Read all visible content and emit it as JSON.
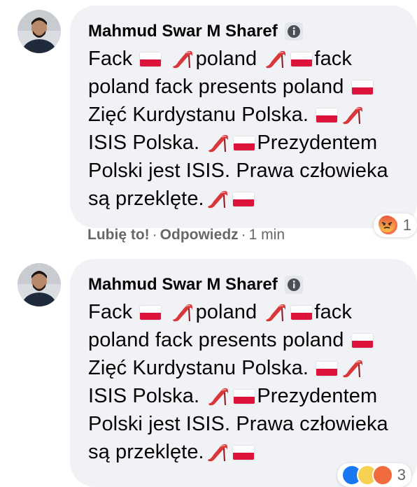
{
  "comments": [
    {
      "author": "Mahmud Swar M Sharef",
      "text_lines": [
        [
          {
            "t": "text",
            "v": "Fack "
          },
          {
            "t": "flag"
          },
          {
            "t": "text",
            "v": " "
          },
          {
            "t": "shoe"
          },
          {
            "t": "text",
            "v": "poland "
          },
          {
            "t": "shoe"
          },
          {
            "t": "flag"
          },
          {
            "t": "text",
            "v": "fack"
          }
        ],
        [
          {
            "t": "text",
            "v": "poland fack presents poland "
          },
          {
            "t": "flag"
          }
        ],
        [
          {
            "t": "text",
            "v": "Zięć Kurdystanu Polska. "
          },
          {
            "t": "flag"
          },
          {
            "t": "shoe"
          }
        ],
        [
          {
            "t": "text",
            "v": "ISIS Polska. "
          },
          {
            "t": "shoe"
          },
          {
            "t": "flag"
          },
          {
            "t": "text",
            "v": "Prezydentem"
          }
        ],
        [
          {
            "t": "text",
            "v": "Polski jest ISIS. Prawa człowieka"
          }
        ],
        [
          {
            "t": "text",
            "v": "są przeklęte."
          },
          {
            "t": "shoe"
          },
          {
            "t": "flag"
          }
        ]
      ],
      "actions": {
        "like": "Lubię to!",
        "reply": "Odpowiedz",
        "time": "1 min",
        "separator": "·"
      },
      "reaction": {
        "icons": [
          "angry-reaction-icon"
        ],
        "count": "1"
      }
    },
    {
      "author": "Mahmud Swar M Sharef",
      "text_lines": [
        [
          {
            "t": "text",
            "v": "Fack "
          },
          {
            "t": "flag"
          },
          {
            "t": "text",
            "v": " "
          },
          {
            "t": "shoe"
          },
          {
            "t": "text",
            "v": "poland "
          },
          {
            "t": "shoe"
          },
          {
            "t": "flag"
          },
          {
            "t": "text",
            "v": "fack"
          }
        ],
        [
          {
            "t": "text",
            "v": "poland fack presents poland "
          },
          {
            "t": "flag"
          }
        ],
        [
          {
            "t": "text",
            "v": "Zięć Kurdystanu Polska. "
          },
          {
            "t": "flag"
          },
          {
            "t": "shoe"
          }
        ],
        [
          {
            "t": "text",
            "v": "ISIS Polska. "
          },
          {
            "t": "shoe"
          },
          {
            "t": "flag"
          },
          {
            "t": "text",
            "v": "Prezydentem"
          }
        ],
        [
          {
            "t": "text",
            "v": "Polski jest ISIS. Prawa człowieka"
          }
        ],
        [
          {
            "t": "text",
            "v": "są przeklęte."
          },
          {
            "t": "shoe"
          },
          {
            "t": "flag"
          }
        ]
      ],
      "reaction": {
        "icons": [
          "like-reaction-icon",
          "haha-reaction-icon",
          "angry-reaction-icon"
        ],
        "count": "3"
      }
    }
  ],
  "colors": {
    "bubble": "#f0f2f5",
    "meta_text": "#65676b",
    "flag_red": "#dc143c",
    "shoe_red": "#d8383a"
  }
}
